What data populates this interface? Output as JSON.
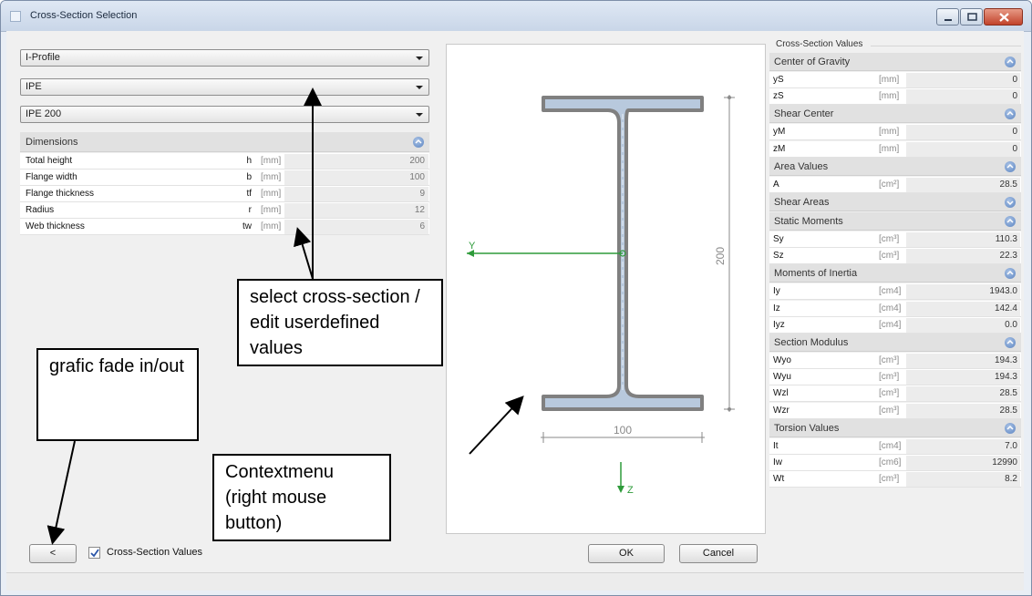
{
  "window": {
    "title": "Cross-Section Selection"
  },
  "left": {
    "combo_type": "I-Profile",
    "combo_series": "IPE",
    "combo_profile": "IPE 200",
    "dimensions_header": "Dimensions",
    "dimensions": [
      {
        "label": "Total height",
        "symbol": "h",
        "unit": "[mm]",
        "value": "200"
      },
      {
        "label": "Flange width",
        "symbol": "b",
        "unit": "[mm]",
        "value": "100"
      },
      {
        "label": "Flange thickness",
        "symbol": "tf",
        "unit": "[mm]",
        "value": "9"
      },
      {
        "label": "Radius",
        "symbol": "r",
        "unit": "[mm]",
        "value": "12"
      },
      {
        "label": "Web thickness",
        "symbol": "tw",
        "unit": "[mm]",
        "value": "6"
      }
    ],
    "back_button": "<",
    "checkbox_label": "Cross-Section Values",
    "checkbox_checked": true
  },
  "graphic": {
    "y_axis_label": "Y",
    "z_axis_label": "Z",
    "height_dim": "200",
    "width_dim": "100",
    "section_fill": "#b8c9dd",
    "section_stroke": "#808080"
  },
  "buttons": {
    "ok": "OK",
    "cancel": "Cancel"
  },
  "right": {
    "title": "Cross-Section Values",
    "groups": [
      {
        "header": "Center of Gravity",
        "expanded": true,
        "rows": [
          {
            "label": "yS",
            "unit": "[mm]",
            "value": "0"
          },
          {
            "label": "zS",
            "unit": "[mm]",
            "value": "0"
          }
        ]
      },
      {
        "header": "Shear Center",
        "expanded": true,
        "rows": [
          {
            "label": "yM",
            "unit": "[mm]",
            "value": "0"
          },
          {
            "label": "zM",
            "unit": "[mm]",
            "value": "0"
          }
        ]
      },
      {
        "header": "Area Values",
        "expanded": true,
        "rows": [
          {
            "label": "A",
            "unit": "[cm²]",
            "value": "28.5"
          }
        ]
      },
      {
        "header": "Shear Areas",
        "expanded": false,
        "rows": []
      },
      {
        "header": "Static Moments",
        "expanded": true,
        "rows": [
          {
            "label": "Sy",
            "unit": "[cm³]",
            "value": "110.3"
          },
          {
            "label": "Sz",
            "unit": "[cm³]",
            "value": "22.3"
          }
        ]
      },
      {
        "header": "Moments of Inertia",
        "expanded": true,
        "rows": [
          {
            "label": "Iy",
            "unit": "[cm4]",
            "value": "1943.0"
          },
          {
            "label": "Iz",
            "unit": "[cm4]",
            "value": "142.4"
          },
          {
            "label": "Iyz",
            "unit": "[cm4]",
            "value": "0.0"
          }
        ]
      },
      {
        "header": "Section Modulus",
        "expanded": true,
        "rows": [
          {
            "label": "Wyo",
            "unit": "[cm³]",
            "value": "194.3"
          },
          {
            "label": "Wyu",
            "unit": "[cm³]",
            "value": "194.3"
          },
          {
            "label": "Wzl",
            "unit": "[cm³]",
            "value": "28.5"
          },
          {
            "label": "Wzr",
            "unit": "[cm³]",
            "value": "28.5"
          }
        ]
      },
      {
        "header": "Torsion Values",
        "expanded": true,
        "rows": [
          {
            "label": "It",
            "unit": "[cm4]",
            "value": "7.0"
          },
          {
            "label": "Iw",
            "unit": "[cm6]",
            "value": "12990"
          },
          {
            "label": "Wt",
            "unit": "[cm³]",
            "value": "8.2"
          }
        ]
      }
    ]
  },
  "callouts": {
    "select": "select cross-section / edit userdefined values",
    "fade": "grafic fade in/out",
    "context": "Contextmenu (right mouse button)"
  },
  "colors": {
    "accent_icon": "#5b84c1",
    "close_button": "#c2432b",
    "axis_green": "#2e9b3a"
  }
}
